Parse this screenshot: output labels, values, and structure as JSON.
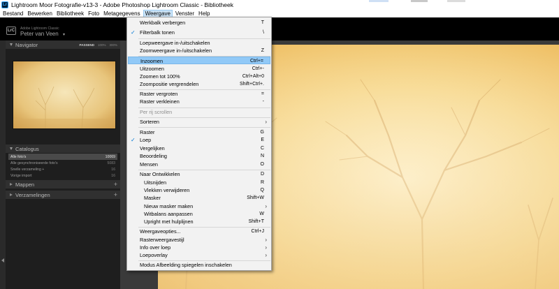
{
  "window": {
    "title": "Lightroom Moor Fotografie-v13-3 - Adobe Photoshop Lightroom Classic - Bibliotheek",
    "app_icon": "Lr"
  },
  "menubar": [
    "Bestand",
    "Bewerken",
    "Bibliotheek",
    "Foto",
    "Metagegevens",
    "Weergave",
    "Venster",
    "Help"
  ],
  "identity": {
    "logo": "LrC",
    "app_name": "Adobe Lightroom Classic",
    "user": "Peter van Veen",
    "chevron": "▾"
  },
  "navigator": {
    "title": "Navigator",
    "zoom_options": [
      "PASSEND",
      "100%",
      "300%"
    ],
    "active_zoom": "PASSEND"
  },
  "catalog": {
    "title": "Catalogus",
    "items": [
      {
        "name": "Alle foto's",
        "count": "10069",
        "selected": true
      },
      {
        "name": "Alle gesynchroniseerde foto's",
        "count": "5083",
        "selected": false
      },
      {
        "name": "Snelle verzameling  +",
        "count": "16",
        "selected": false
      },
      {
        "name": "Vorige import",
        "count": "16",
        "selected": false
      }
    ]
  },
  "folders": {
    "title": "Mappen",
    "add": "+"
  },
  "collections": {
    "title": "Verzamelingen",
    "add": "+"
  },
  "view_menu": {
    "items": [
      {
        "label": "Werkbalk verbergen",
        "shortcut": "T",
        "checked": false
      },
      {
        "label": "Filterbalk tonen",
        "shortcut": "\\",
        "checked": true
      },
      {
        "label": "Loepweergave in-/uitschakelen",
        "shortcut": "",
        "checked": false
      },
      {
        "label": "Zoomweergave in-/uitschakelen",
        "shortcut": "Z",
        "checked": false
      },
      {
        "label": "Inzoomen",
        "shortcut": "Ctrl+=",
        "checked": false,
        "highlighted": true
      },
      {
        "label": "Uitzoomen",
        "shortcut": "Ctrl+-",
        "checked": false
      },
      {
        "label": "Zoomen tot 100%",
        "shortcut": "Ctrl+Alt+0",
        "checked": false
      },
      {
        "label": "Zoompositie vergrendelen",
        "shortcut": "Shift+Ctrl+.",
        "checked": false
      },
      {
        "label": "Raster vergroten",
        "shortcut": "=",
        "checked": false
      },
      {
        "label": "Raster verkleinen",
        "shortcut": "-",
        "checked": false
      },
      {
        "label": "Per rij scrollen",
        "shortcut": "",
        "checked": false,
        "disabled": true
      },
      {
        "label": "Sorteren",
        "shortcut": "",
        "checked": false,
        "submenu": true
      },
      {
        "label": "Raster",
        "shortcut": "G",
        "checked": false
      },
      {
        "label": "Loep",
        "shortcut": "E",
        "checked": true
      },
      {
        "label": "Vergelijken",
        "shortcut": "C",
        "checked": false
      },
      {
        "label": "Beoordeling",
        "shortcut": "N",
        "checked": false
      },
      {
        "label": "Mensen",
        "shortcut": "O",
        "checked": false
      },
      {
        "label": "Naar Ontwikkelen",
        "shortcut": "D",
        "checked": false
      },
      {
        "label": "Uitsnijden",
        "shortcut": "R",
        "checked": false,
        "indent": true
      },
      {
        "label": "Vlekken verwijderen",
        "shortcut": "Q",
        "checked": false,
        "indent": true
      },
      {
        "label": "Masker",
        "shortcut": "Shift+W",
        "checked": false,
        "indent": true
      },
      {
        "label": "Nieuw masker maken",
        "shortcut": "",
        "checked": false,
        "indent": true,
        "submenu": true
      },
      {
        "label": "Witbalans aanpassen",
        "shortcut": "W",
        "checked": false,
        "indent": true
      },
      {
        "label": "Upright met hulplijnen",
        "shortcut": "Shift+T",
        "checked": false,
        "indent": true
      },
      {
        "label": "Weergaveopties...",
        "shortcut": "Ctrl+J",
        "checked": false
      },
      {
        "label": "Rasterweergavestijl",
        "shortcut": "",
        "checked": false,
        "submenu": true
      },
      {
        "label": "Info over loep",
        "shortcut": "",
        "checked": false,
        "submenu": true
      },
      {
        "label": "Loepoverlay",
        "shortcut": "",
        "checked": false,
        "submenu": true
      },
      {
        "label": "Modus Afbeelding spiegelen inschakelen",
        "shortcut": "",
        "checked": false
      }
    ]
  },
  "colors": {
    "menu_highlight": "#91c9f7",
    "check_accent": "#0078d4",
    "photo_glow": "#fff2cc",
    "photo_edge": "#e0a740"
  }
}
